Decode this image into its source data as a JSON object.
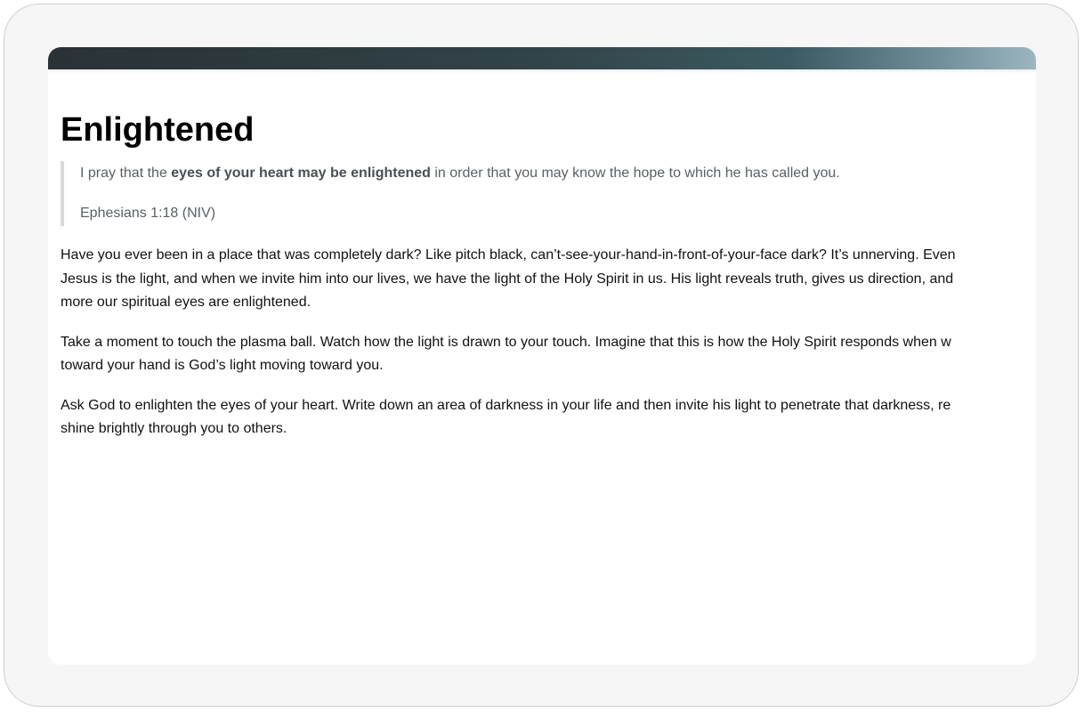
{
  "page": {
    "title": "Enlightened"
  },
  "quote": {
    "text_before": "I pray that the ",
    "text_bold": "eyes of your heart may be enlightened",
    "text_after": " in order that you may know the hope to which he has called you.",
    "reference": "Ephesians 1:18 (NIV)"
  },
  "paragraphs": [
    {
      "lines": [
        "Have you ever been in a place that was completely dark? Like pitch black, can’t-see-your-hand-in-front-of-your-face dark? It’s unnerving. Even",
        "Jesus is the light, and when we invite him into our lives, we have the light of the Holy Spirit in us. His light reveals truth, gives us direction, and",
        "more our spiritual eyes are enlightened."
      ]
    },
    {
      "lines": [
        "Take a moment to touch the plasma ball. Watch how the light is drawn to your touch. Imagine that this is how the Holy Spirit responds when w",
        "toward your hand is God’s light moving toward you."
      ]
    },
    {
      "lines": [
        "Ask God to enlighten the eyes of your heart. Write down an area of darkness in your life and then invite his light to penetrate that darkness, re",
        "shine brightly through you to others."
      ]
    }
  ]
}
